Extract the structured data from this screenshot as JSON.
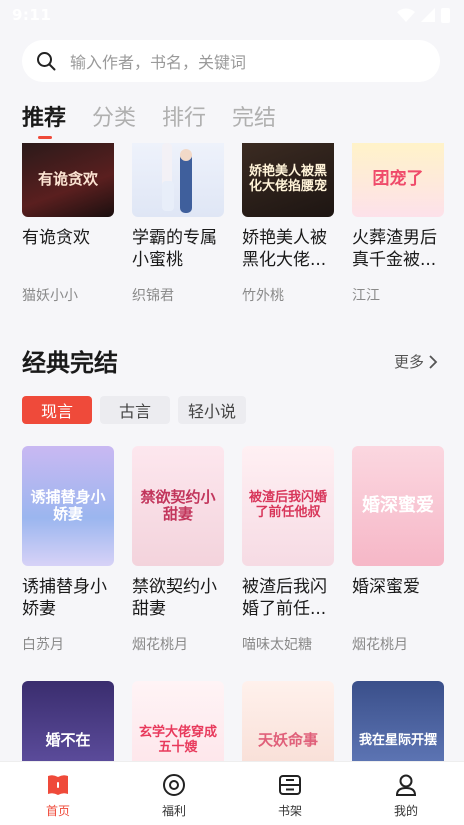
{
  "status": {
    "time": "9:11"
  },
  "search": {
    "placeholder": "输入作者，书名，关键词"
  },
  "tabs": [
    {
      "label": "推荐",
      "active": true
    },
    {
      "label": "分类"
    },
    {
      "label": "排行"
    },
    {
      "label": "完结"
    }
  ],
  "top_books": [
    {
      "title": "有诡贪欢",
      "author": "猫妖小小",
      "cover_text": "有诡贪欢"
    },
    {
      "title": "学霸的专属小蜜桃",
      "author": "织锦君",
      "cover_text": ""
    },
    {
      "title": "娇艳美人被黑化大佬...",
      "author": "竹外桃",
      "cover_text": "娇艳美人被黑化大佬掐腰宠"
    },
    {
      "title": "火葬渣男后真千金被...",
      "author": "江江",
      "cover_text": "团宠了"
    }
  ],
  "section": {
    "title": "经典完结",
    "more": "更多"
  },
  "genres": [
    {
      "label": "现言",
      "active": true
    },
    {
      "label": "古言"
    },
    {
      "label": "轻小说"
    }
  ],
  "mid_books": [
    {
      "title": "诱捕替身小娇妻",
      "author": "白苏月",
      "cover_text": "诱捕替身小娇妻"
    },
    {
      "title": "禁欲契约小甜妻",
      "author": "烟花桃月",
      "cover_text": "禁欲契约小甜妻"
    },
    {
      "title": "被渣后我闪婚了前任...",
      "author": "喵味太妃糖",
      "cover_text": "被渣后我闪婚了前任他叔"
    },
    {
      "title": "婚深蜜爱",
      "author": "烟花桃月",
      "cover_text": "婚深蜜爱"
    }
  ],
  "bottom_books": [
    {
      "cover_text": "婚不在"
    },
    {
      "cover_text": "玄学大佬穿成五十嫂"
    },
    {
      "cover_text": "天妖命事"
    },
    {
      "cover_text": "我在星际开摆"
    }
  ],
  "nav": [
    {
      "label": "首页",
      "active": true,
      "icon": "book-icon"
    },
    {
      "label": "福利",
      "icon": "coin-icon"
    },
    {
      "label": "书架",
      "icon": "bookshelf-icon"
    },
    {
      "label": "我的",
      "icon": "profile-icon"
    }
  ],
  "colors": {
    "accent": "#ef4a3a",
    "background": "#f6f6f9"
  }
}
